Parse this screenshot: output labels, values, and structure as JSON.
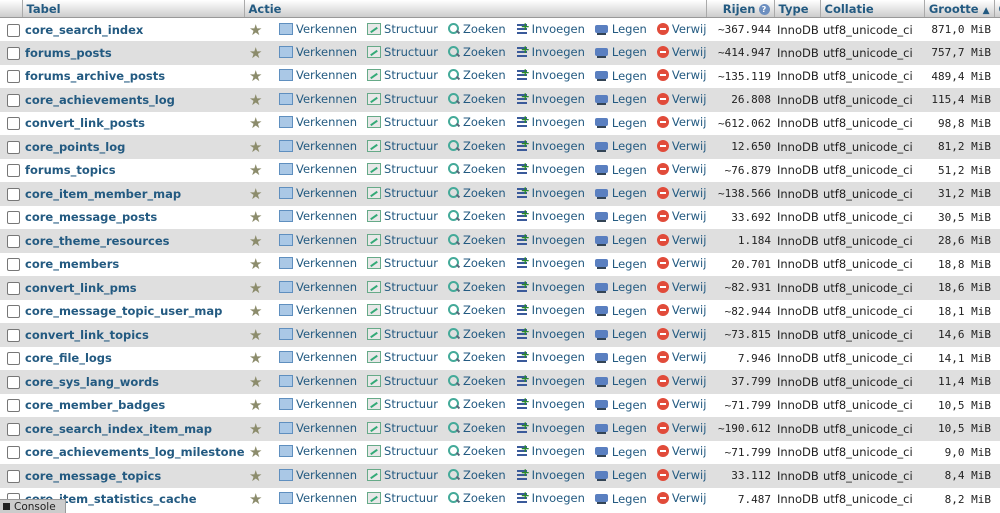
{
  "header": {
    "table": "Tabel",
    "action": "Actie",
    "rows": "Rijen",
    "type": "Type",
    "collation": "Collatie",
    "size": "Grootte",
    "sort_indicator": "▲",
    "extra": "C"
  },
  "actions": {
    "browse": "Verkennen",
    "structure": "Structuur",
    "search": "Zoeken",
    "insert": "Invoegen",
    "empty": "Legen",
    "drop": "Verwijderen"
  },
  "rows": [
    {
      "name": "core_search_index",
      "rows": "~367.944",
      "type": "InnoDB",
      "collation": "utf8_unicode_ci",
      "size": "871,0 MiB"
    },
    {
      "name": "forums_posts",
      "rows": "~414.947",
      "type": "InnoDB",
      "collation": "utf8_unicode_ci",
      "size": "757,7 MiB"
    },
    {
      "name": "forums_archive_posts",
      "rows": "~135.119",
      "type": "InnoDB",
      "collation": "utf8_unicode_ci",
      "size": "489,4 MiB"
    },
    {
      "name": "core_achievements_log",
      "rows": "26.808",
      "type": "InnoDB",
      "collation": "utf8_unicode_ci",
      "size": "115,4 MiB"
    },
    {
      "name": "convert_link_posts",
      "rows": "~612.062",
      "type": "InnoDB",
      "collation": "utf8_unicode_ci",
      "size": "98,8 MiB"
    },
    {
      "name": "core_points_log",
      "rows": "12.650",
      "type": "InnoDB",
      "collation": "utf8_unicode_ci",
      "size": "81,2 MiB"
    },
    {
      "name": "forums_topics",
      "rows": "~76.879",
      "type": "InnoDB",
      "collation": "utf8_unicode_ci",
      "size": "51,2 MiB"
    },
    {
      "name": "core_item_member_map",
      "rows": "~138.566",
      "type": "InnoDB",
      "collation": "utf8_unicode_ci",
      "size": "31,2 MiB"
    },
    {
      "name": "core_message_posts",
      "rows": "33.692",
      "type": "InnoDB",
      "collation": "utf8_unicode_ci",
      "size": "30,5 MiB"
    },
    {
      "name": "core_theme_resources",
      "rows": "1.184",
      "type": "InnoDB",
      "collation": "utf8_unicode_ci",
      "size": "28,6 MiB"
    },
    {
      "name": "core_members",
      "rows": "20.701",
      "type": "InnoDB",
      "collation": "utf8_unicode_ci",
      "size": "18,8 MiB"
    },
    {
      "name": "convert_link_pms",
      "rows": "~82.931",
      "type": "InnoDB",
      "collation": "utf8_unicode_ci",
      "size": "18,6 MiB"
    },
    {
      "name": "core_message_topic_user_map",
      "rows": "~82.944",
      "type": "InnoDB",
      "collation": "utf8_unicode_ci",
      "size": "18,1 MiB"
    },
    {
      "name": "convert_link_topics",
      "rows": "~73.815",
      "type": "InnoDB",
      "collation": "utf8_unicode_ci",
      "size": "14,6 MiB"
    },
    {
      "name": "core_file_logs",
      "rows": "7.946",
      "type": "InnoDB",
      "collation": "utf8_unicode_ci",
      "size": "14,1 MiB"
    },
    {
      "name": "core_sys_lang_words",
      "rows": "37.799",
      "type": "InnoDB",
      "collation": "utf8_unicode_ci",
      "size": "11,4 MiB"
    },
    {
      "name": "core_member_badges",
      "rows": "~71.799",
      "type": "InnoDB",
      "collation": "utf8_unicode_ci",
      "size": "10,5 MiB"
    },
    {
      "name": "core_search_index_item_map",
      "rows": "~190.612",
      "type": "InnoDB",
      "collation": "utf8_unicode_ci",
      "size": "10,5 MiB"
    },
    {
      "name": "core_achievements_log_milestones",
      "rows": "~71.799",
      "type": "InnoDB",
      "collation": "utf8_unicode_ci",
      "size": "9,0 MiB"
    },
    {
      "name": "core_message_topics",
      "rows": "33.112",
      "type": "InnoDB",
      "collation": "utf8_unicode_ci",
      "size": "8,4 MiB"
    },
    {
      "name": "core_item_statistics_cache",
      "rows": "7.487",
      "type": "InnoDB",
      "collation": "utf8_unicode_ci",
      "size": "8,2 MiB"
    }
  ],
  "console": {
    "label": "Console"
  },
  "colors": {
    "link": "#235a81",
    "row_alt": "#dfdfdf",
    "drop": "#e14b3a"
  }
}
